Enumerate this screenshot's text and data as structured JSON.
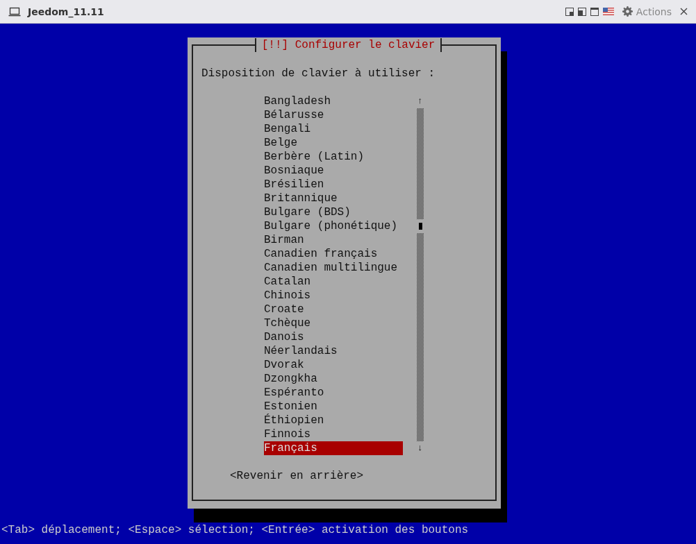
{
  "window": {
    "title": "Jeedom_11.11",
    "actions_label": "Actions"
  },
  "dialog": {
    "title": "[!!] Configurer le clavier",
    "prompt": "Disposition de clavier à utiliser :",
    "items": [
      {
        "label": "Bangladesh",
        "selected": false
      },
      {
        "label": "Bélarusse",
        "selected": false
      },
      {
        "label": "Bengali",
        "selected": false
      },
      {
        "label": "Belge",
        "selected": false
      },
      {
        "label": "Berbère (Latin)",
        "selected": false
      },
      {
        "label": "Bosniaque",
        "selected": false
      },
      {
        "label": "Brésilien",
        "selected": false
      },
      {
        "label": "Britannique",
        "selected": false
      },
      {
        "label": "Bulgare (BDS)",
        "selected": false
      },
      {
        "label": "Bulgare (phonétique)",
        "selected": false
      },
      {
        "label": "Birman",
        "selected": false
      },
      {
        "label": "Canadien français",
        "selected": false
      },
      {
        "label": "Canadien multilingue",
        "selected": false
      },
      {
        "label": "Catalan",
        "selected": false
      },
      {
        "label": "Chinois",
        "selected": false
      },
      {
        "label": "Croate",
        "selected": false
      },
      {
        "label": "Tchèque",
        "selected": false
      },
      {
        "label": "Danois",
        "selected": false
      },
      {
        "label": "Néerlandais",
        "selected": false
      },
      {
        "label": "Dvorak",
        "selected": false
      },
      {
        "label": "Dzongkha",
        "selected": false
      },
      {
        "label": "Espéranto",
        "selected": false
      },
      {
        "label": "Estonien",
        "selected": false
      },
      {
        "label": "Éthiopien",
        "selected": false
      },
      {
        "label": "Finnois",
        "selected": false
      },
      {
        "label": "Français",
        "selected": true
      }
    ],
    "up_arrow": "↑",
    "down_arrow": "↓",
    "back_button": "<Revenir en arrière>"
  },
  "status_line": "<Tab> déplacement; <Espace> sélection; <Entrée> activation des boutons"
}
